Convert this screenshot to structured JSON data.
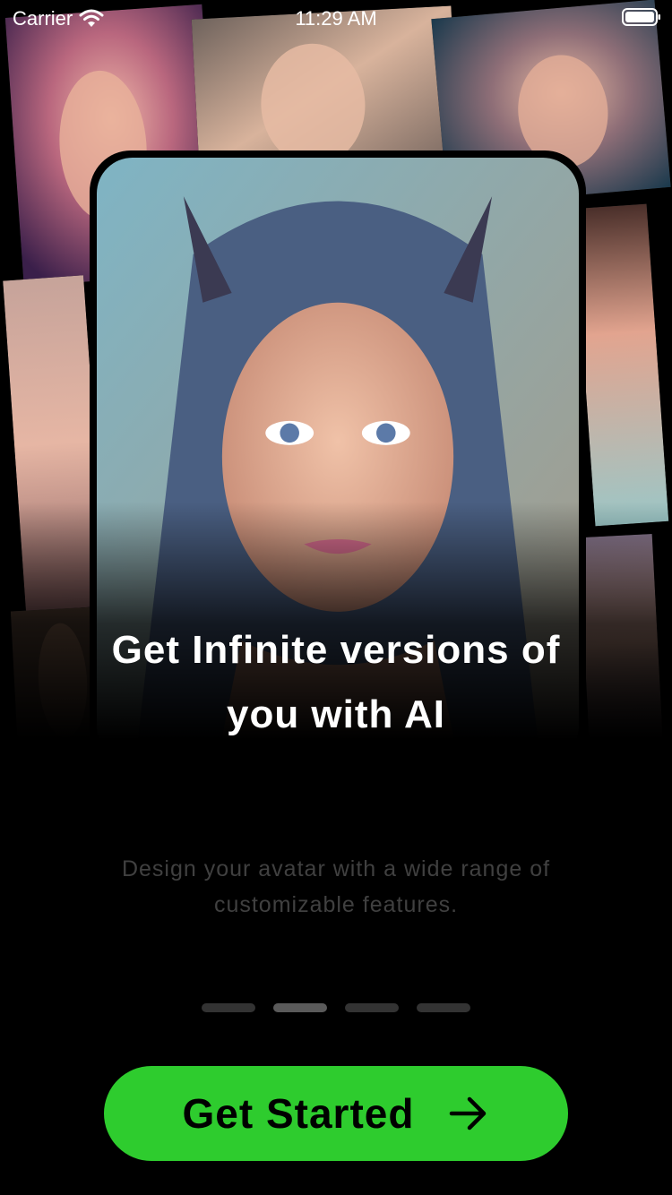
{
  "status_bar": {
    "carrier": "Carrier",
    "time": "11:29 AM",
    "wifi_icon": "wifi-icon",
    "battery_icon": "battery-icon"
  },
  "onboarding": {
    "headline": "Get Infinite versions of you with AI",
    "subtitle": "Design your avatar with a wide range of customizable features.",
    "pages_total": 4,
    "active_page": 2
  },
  "cta": {
    "label": "Get Started",
    "icon": "arrow-right-icon"
  },
  "colors": {
    "background": "#000000",
    "accent": "#2ECC2E",
    "subtitle_text": "#404040"
  }
}
